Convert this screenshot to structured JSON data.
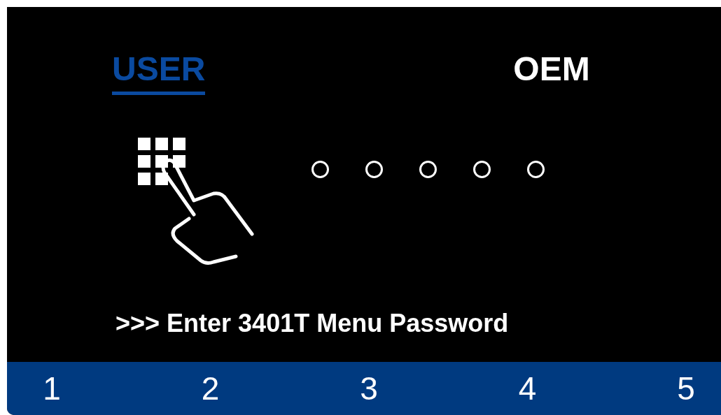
{
  "tabs": [
    {
      "label": "USER",
      "selected": true
    },
    {
      "label": "OEM",
      "selected": false
    }
  ],
  "password_dots": [
    {
      "filled": false
    },
    {
      "filled": false
    },
    {
      "filled": false
    },
    {
      "filled": false
    },
    {
      "filled": false
    }
  ],
  "prompt": ">>> Enter 3401T Menu Password",
  "soft_keys": [
    "1",
    "2",
    "3",
    "4",
    "5"
  ]
}
